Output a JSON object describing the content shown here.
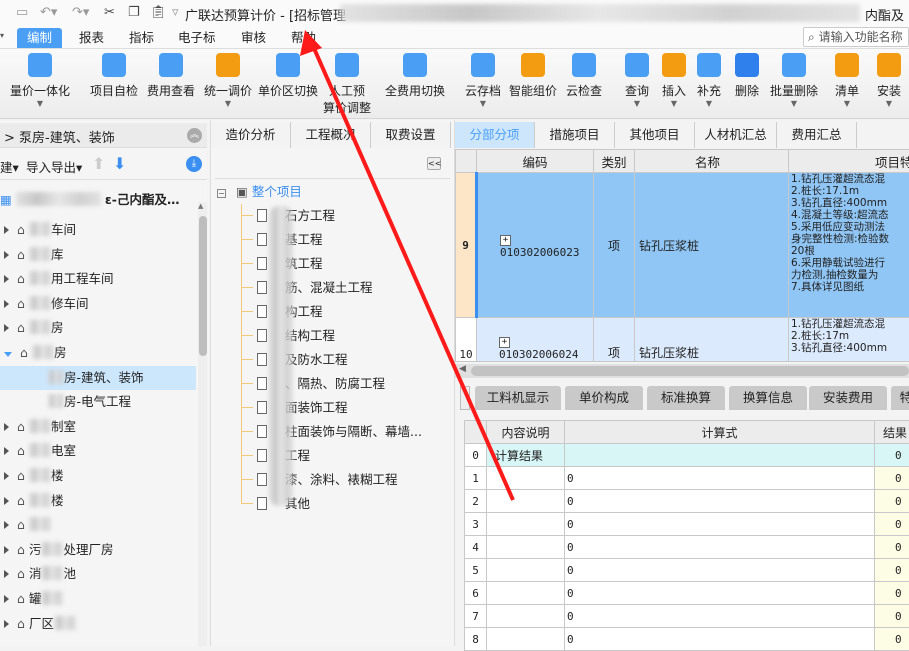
{
  "titlebar": {
    "title": "广联达预算计价 - [招标管理",
    "title_tail": "内酯及联"
  },
  "quick_access": [
    "save-icon",
    "undo-icon",
    "redo-icon",
    "cut-icon",
    "copy-icon",
    "paste-icon"
  ],
  "menu": {
    "items": [
      "编制",
      "报表",
      "指标",
      "电子标",
      "审核",
      "帮助"
    ],
    "active": 0
  },
  "search": {
    "placeholder": "请输入功能名称"
  },
  "toolbar": {
    "items": [
      {
        "label": "量价一体化",
        "icon": "price-integration-icon",
        "color": "#4a9ff5"
      },
      {
        "label": "项目自检",
        "icon": "self-check-icon",
        "color": "#4a9ff5"
      },
      {
        "label": "费用查看",
        "icon": "fee-view-icon",
        "color": "#4a9ff5"
      },
      {
        "label": "统一调价",
        "icon": "adjust-price-icon",
        "color": "#f39c12"
      },
      {
        "label": "单价区切换",
        "icon": "unit-price-switch-icon",
        "color": "#4a9ff5"
      },
      {
        "label": "人工预",
        "label2": "算价调整",
        "icon": "labor-adjust-icon",
        "color": "#4a9ff5"
      },
      {
        "label": "全费用切换",
        "icon": "full-fee-switch-icon",
        "color": "#4a9ff5"
      },
      {
        "label": "云存档",
        "icon": "cloud-save-icon",
        "color": "#4a9ff5"
      },
      {
        "label": "智能组价",
        "icon": "smart-price-icon",
        "color": "#f39c12"
      },
      {
        "label": "云检查",
        "icon": "cloud-check-icon",
        "color": "#4a9ff5"
      },
      {
        "label": "查询",
        "icon": "query-icon",
        "color": "#4a9ff5"
      },
      {
        "label": "插入",
        "icon": "insert-icon",
        "color": "#f39c12"
      },
      {
        "label": "补充",
        "icon": "supplement-icon",
        "color": "#4a9ff5"
      },
      {
        "label": "删除",
        "icon": "delete-icon",
        "color": "#2f80ed"
      },
      {
        "label": "批量删除",
        "icon": "batch-delete-icon",
        "color": "#4a9ff5"
      },
      {
        "label": "清单",
        "icon": "list-icon",
        "color": "#f39c12"
      },
      {
        "label": "安装",
        "icon": "install-icon",
        "color": "#f39c12"
      }
    ]
  },
  "left": {
    "breadcrumb": "泵房-建筑、装饰",
    "import_export": "导入导出",
    "root": "ε-己内酯及…",
    "items": [
      {
        "label": "车间",
        "type": "node"
      },
      {
        "label": "库",
        "type": "node"
      },
      {
        "label": "用工程车间",
        "type": "node"
      },
      {
        "label": "修车间",
        "type": "node"
      },
      {
        "label": "房",
        "type": "node"
      },
      {
        "label": "房",
        "type": "open"
      },
      {
        "label": "房-建筑、装饰",
        "type": "leaf",
        "selected": true
      },
      {
        "label": "房-电气工程",
        "type": "leaf"
      },
      {
        "label": "制室",
        "type": "node"
      },
      {
        "label": "电室",
        "type": "node"
      },
      {
        "label": "楼",
        "type": "node"
      },
      {
        "label": "楼",
        "type": "node"
      },
      {
        "label": "",
        "type": "node"
      },
      {
        "label": "处理厂房",
        "prefix": "污",
        "type": "node"
      },
      {
        "label": "池",
        "prefix": "消",
        "type": "node"
      },
      {
        "label": "",
        "prefix": "罐",
        "type": "node"
      },
      {
        "label": "",
        "prefix": "厂区",
        "type": "node"
      }
    ]
  },
  "middle": {
    "tabs": [
      "造价分析",
      "工程概况",
      "取费设置"
    ],
    "root": "整个项目",
    "items": [
      "石方工程",
      "基工程",
      "筑工程",
      "筋、混凝土工程",
      "构工程",
      "结构工程",
      "及防水工程",
      "、隔热、防腐工程",
      "面装饰工程",
      "柱面装饰与隔断、幕墙...",
      "工程",
      "漆、涂料、裱糊工程",
      "其他"
    ]
  },
  "right": {
    "tabs": [
      "分部分项",
      "措施项目",
      "其他项目",
      "人材机汇总",
      "费用汇总"
    ],
    "active_tab": 0,
    "columns": [
      "编码",
      "类别",
      "名称",
      "项目特征"
    ],
    "rows": [
      {
        "num": "9",
        "code": "010302006023",
        "type": "项",
        "name": "钻孔压浆桩",
        "features": [
          "1.钻孔压灌超流态混",
          "2.桩长:17.1m",
          "3.钻孔直径:400mm",
          "4.混凝土等级:超流态",
          "5.采用低应变动测法",
          "身完整性检测:检验数",
          "20根",
          "6.采用静载试验进行",
          "力检测,抽检数量为",
          "7.具体详见图纸"
        ]
      },
      {
        "num": "10",
        "code": "010302006024",
        "type": "项",
        "name": "钻孔压浆桩",
        "features": [
          "1.钻孔压灌超流态混",
          "2.桩长:17m",
          "3.钻孔直径:400mm"
        ]
      }
    ],
    "bottom_tabs": [
      "工料机显示",
      "单价构成",
      "标准换算",
      "换算信息",
      "安装费用",
      "特"
    ],
    "lower_columns": [
      "内容说明",
      "计算式",
      "结果"
    ],
    "lower_rows": [
      {
        "num": "0",
        "desc": "计算结果",
        "formula": "",
        "result": "0"
      },
      {
        "num": "1",
        "desc": "",
        "formula": "0",
        "result": "0"
      },
      {
        "num": "2",
        "desc": "",
        "formula": "0",
        "result": "0"
      },
      {
        "num": "3",
        "desc": "",
        "formula": "0",
        "result": "0"
      },
      {
        "num": "4",
        "desc": "",
        "formula": "0",
        "result": "0"
      },
      {
        "num": "5",
        "desc": "",
        "formula": "0",
        "result": "0"
      },
      {
        "num": "6",
        "desc": "",
        "formula": "0",
        "result": "0"
      },
      {
        "num": "7",
        "desc": "",
        "formula": "0",
        "result": "0"
      },
      {
        "num": "8",
        "desc": "",
        "formula": "0",
        "result": "0"
      }
    ]
  },
  "annotation": {
    "color": "#ff1a1a"
  }
}
